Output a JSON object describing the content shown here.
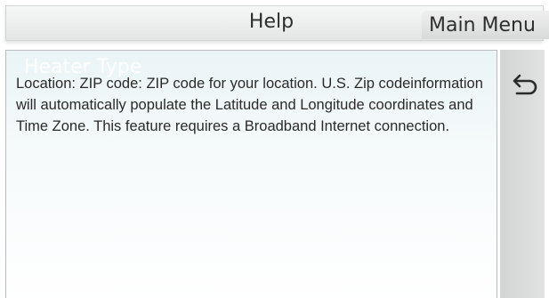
{
  "header": {
    "title": "Help"
  },
  "main_menu": {
    "label": "Main Menu"
  },
  "content": {
    "ghost_heading": "Heater Type",
    "help_text": "Location: ZIP code: ZIP code for your location. U.S. Zip codeinformation will automatically populate the Latitude and Longitude coordinates and Time Zone. This feature requires a Broadband Internet connection."
  },
  "icons": {
    "back": "undo-arrow-icon"
  }
}
